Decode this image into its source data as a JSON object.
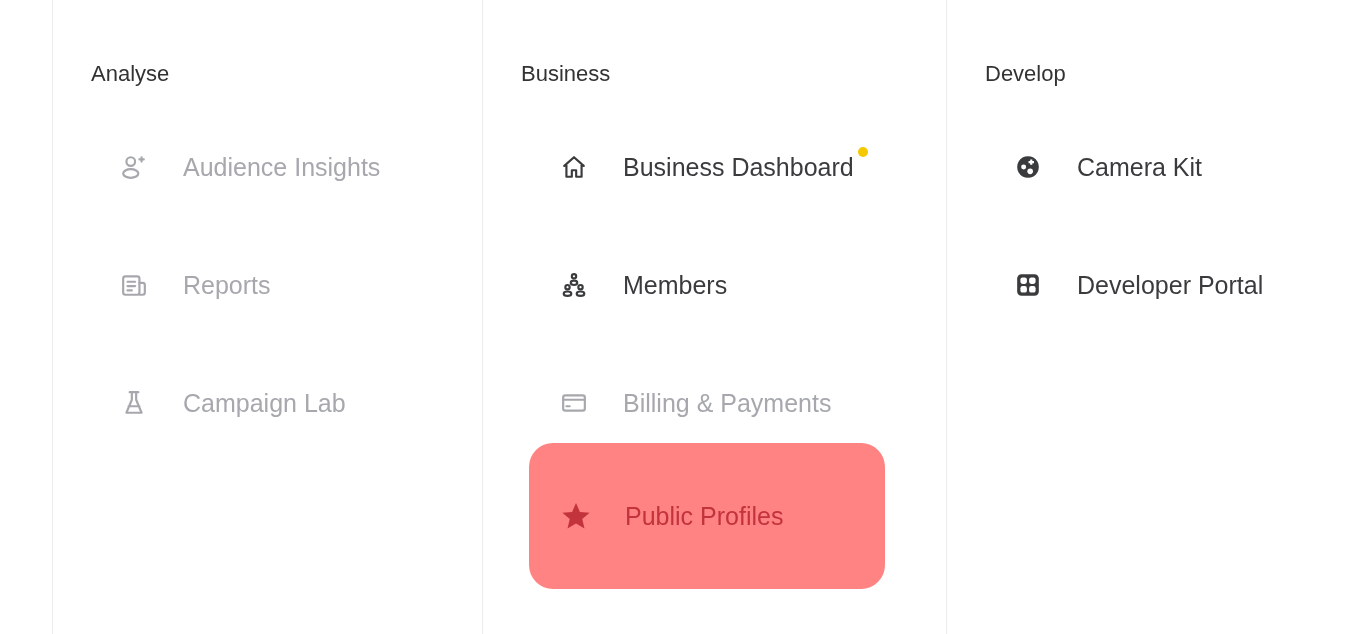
{
  "columns": [
    {
      "heading": "Analyse",
      "items": [
        {
          "label": "Audience Insights",
          "disabled": true,
          "selected": false,
          "notification": false
        },
        {
          "label": "Reports",
          "disabled": true,
          "selected": false,
          "notification": false
        },
        {
          "label": "Campaign Lab",
          "disabled": true,
          "selected": false,
          "notification": false
        }
      ]
    },
    {
      "heading": "Business",
      "items": [
        {
          "label": "Business Dashboard",
          "disabled": false,
          "selected": false,
          "notification": true
        },
        {
          "label": "Members",
          "disabled": false,
          "selected": false,
          "notification": false
        },
        {
          "label": "Billing & Payments",
          "disabled": true,
          "selected": false,
          "notification": false
        },
        {
          "label": "Public Profiles",
          "disabled": false,
          "selected": true,
          "notification": false
        }
      ]
    },
    {
      "heading": "Develop",
      "items": [
        {
          "label": "Camera Kit",
          "disabled": false,
          "selected": false,
          "notification": false
        },
        {
          "label": "Developer Portal",
          "disabled": false,
          "selected": false,
          "notification": false
        }
      ]
    }
  ]
}
